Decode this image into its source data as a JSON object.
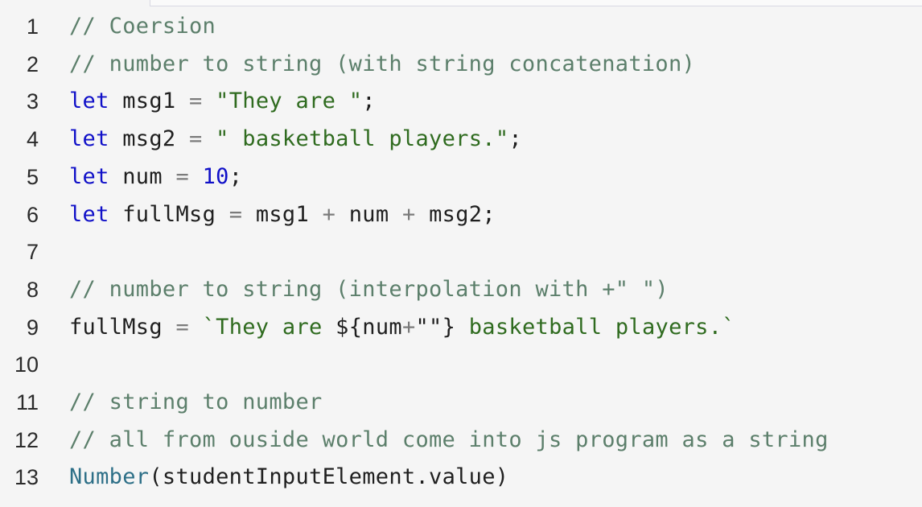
{
  "editor": {
    "line_numbers": [
      "1",
      "2",
      "3",
      "4",
      "5",
      "6",
      "7",
      "8",
      "9",
      "10",
      "11",
      "12",
      "13"
    ],
    "lines": {
      "l1": {
        "comment": "// Coersion"
      },
      "l2": {
        "comment": "// number to string (with string concatenation)"
      },
      "l3": {
        "kw": "let",
        "ident": "msg1",
        "op": "=",
        "str": "\"They are \"",
        "end": ";"
      },
      "l4": {
        "kw": "let",
        "ident": "msg2",
        "op": "=",
        "str": "\" basketball players.\"",
        "end": ";"
      },
      "l5": {
        "kw": "let",
        "ident": "num",
        "op": "=",
        "num": "10",
        "end": ";"
      },
      "l6": {
        "kw": "let",
        "ident": "fullMsg",
        "op": "=",
        "a": "msg1",
        "plus1": "+",
        "b": "num",
        "plus2": "+",
        "c": "msg2",
        "end": ";"
      },
      "l7": {
        "text": ""
      },
      "l8": {
        "comment": "// number to string (interpolation with +\" \")"
      },
      "l9": {
        "ident": "fullMsg",
        "op": "=",
        "tpl_start": "`They are ",
        "interp_open": "${",
        "interp_id": "num",
        "interp_plus": "+",
        "interp_str": "\"\"",
        "interp_close": "}",
        "tpl_end": " basketball players.`"
      },
      "l10": {
        "text": ""
      },
      "l11": {
        "comment": "// string to number"
      },
      "l12": {
        "comment": "// all from ouside world come into js program as a string"
      },
      "l13": {
        "fn": "Number",
        "paren_open": "(",
        "arg": "studentInputElement.value",
        "paren_close": ")"
      }
    }
  },
  "colors": {
    "background": "#f5f5f5",
    "keyword": "#1010c8",
    "string": "#2f6b1f",
    "comment": "#5c7f6b",
    "function": "#2d6f87"
  }
}
